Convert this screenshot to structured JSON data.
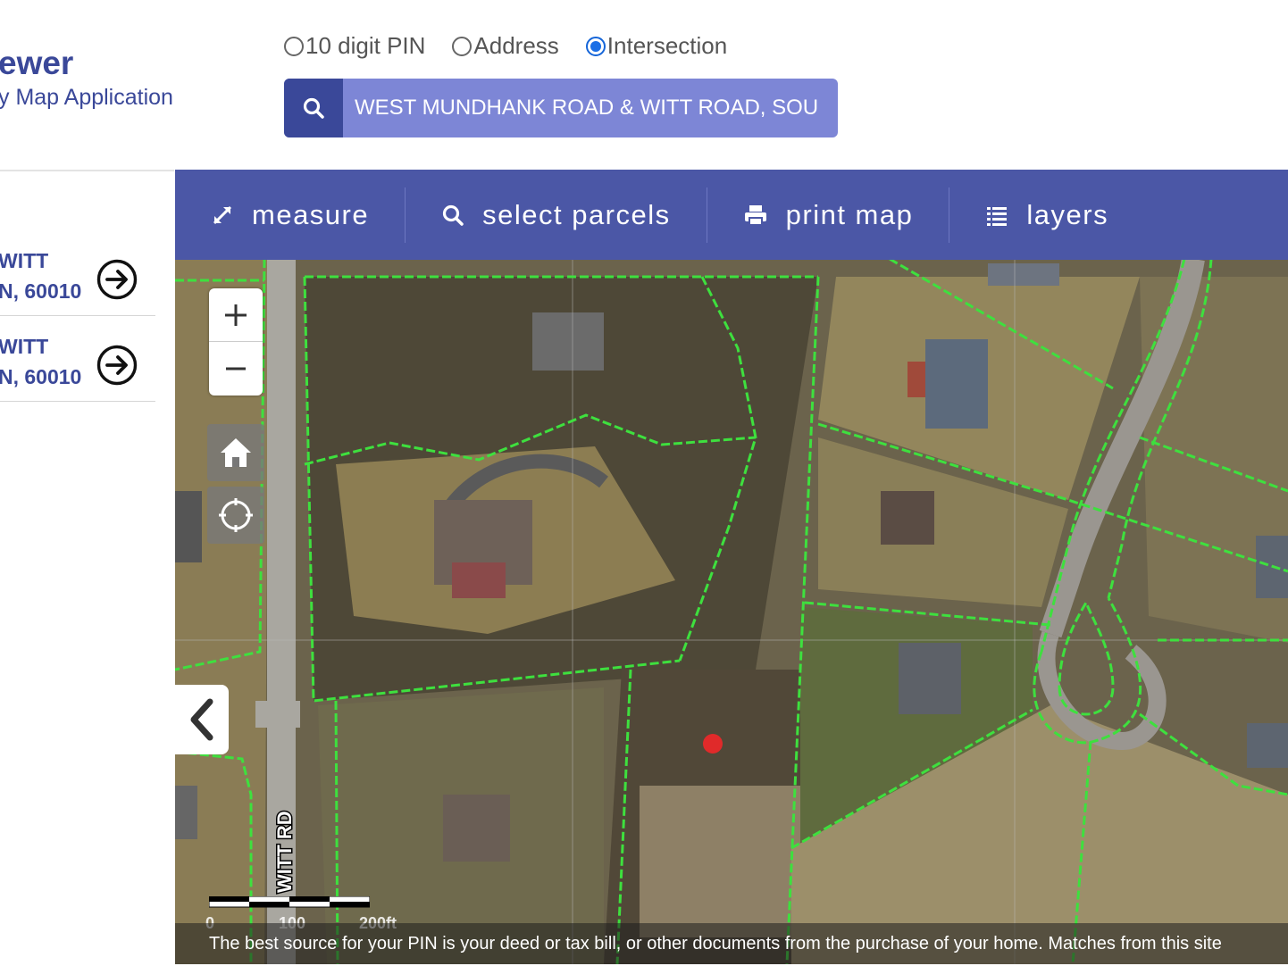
{
  "header": {
    "title": "ewer",
    "subtitle": "y Map Application"
  },
  "search_type": {
    "options": [
      {
        "label": "10 digit PIN",
        "selected": false
      },
      {
        "label": "Address",
        "selected": false
      },
      {
        "label": "Intersection",
        "selected": true
      }
    ]
  },
  "search": {
    "value": "WEST MUNDHANK ROAD & WITT ROAD, SOU"
  },
  "results": [
    {
      "line1": "WITT",
      "line2": "N, 60010"
    },
    {
      "line1": "WITT",
      "line2": "N, 60010"
    }
  ],
  "toolbar": {
    "measure": "measure",
    "select_parcels": "select parcels",
    "print_map": "print map",
    "layers": "layers"
  },
  "map": {
    "road_label": "WITT RD",
    "scale": {
      "zero": "0",
      "mid": "100",
      "end": "200ft"
    },
    "disclaimer": "The best source for your PIN is your deed or tax bill, or other documents from the purchase of your home. Matches from this site",
    "colors": {
      "parcel_lines": "#3ee03e",
      "marker": "#e02a2a",
      "toolbar": "#4b57a6",
      "accent": "#3a4899"
    }
  }
}
